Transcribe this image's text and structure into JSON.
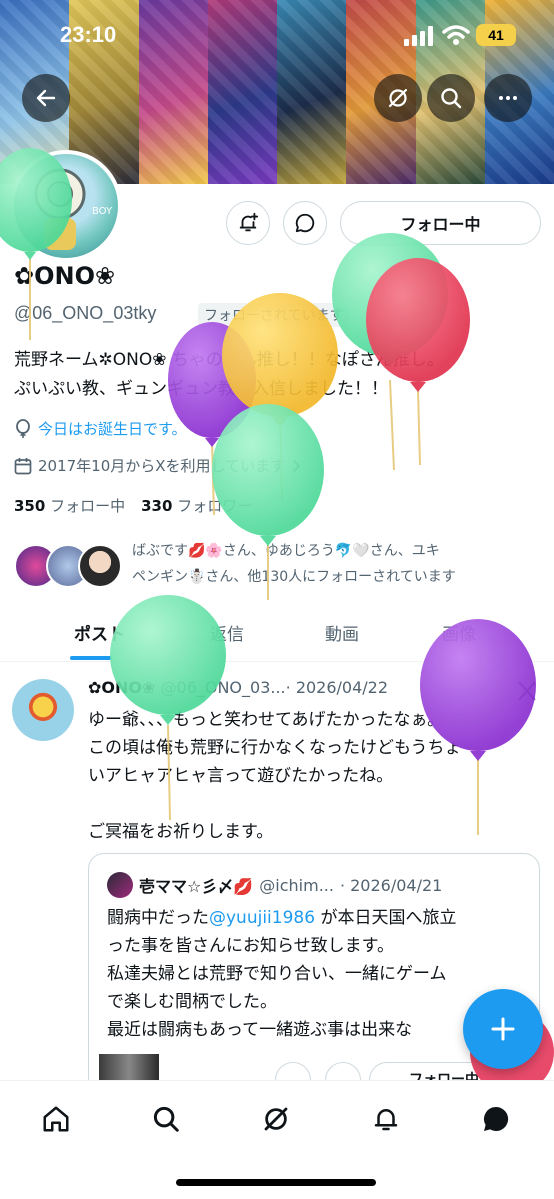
{
  "status_bar": {
    "time": "23:10",
    "battery": "41"
  },
  "banner": {
    "colors": [
      "#4a7fc9",
      "#d8c45a",
      "#5b2f8a",
      "#b43a7a",
      "#3a7ab5",
      "#c24a4a",
      "#3d9a8c",
      "#f1b233"
    ]
  },
  "profile": {
    "name": "✿ONO❀",
    "handle": "@06_ONO_03tky",
    "follows_you": "フォローされています",
    "bio_line1": "荒野ネーム✲ONO❀ ちゃのさん推し！！なぽさん推し。",
    "bio_line2": "ぷいぷい教、ギュンギュン教に入信しました！！",
    "birthday": "今日はお誕生日です。",
    "joined": "2017年10月からXを利用しています",
    "following_count": "350",
    "following_label": "フォロー中",
    "followers_count": "330",
    "followers_label": "フォロワー",
    "followed_by_line1": "ばぶです💋🌸さん、ゆあじろう🐬🤍さん、ユキ",
    "followed_by_line2": "ペンギン☃️さん、他130人にフォローされています",
    "follow_button": "フォロー中"
  },
  "tabs": [
    "ポスト",
    "返信",
    "動画",
    "画像"
  ],
  "post": {
    "author": "✿ONO❀",
    "handle": "@06_ONO_03...",
    "date": "· 2026/04/22",
    "line1": "ゆー爺、、、もっと笑わせてあげたかったなぁ。",
    "line2": "この頃は俺も荒野に行かなくなったけどもうちょ",
    "line3": "いアヒャアヒャ言って遊びたかったね。",
    "line4": "ご冥福をお祈りします。",
    "quote": {
      "author": "壱ママ☆彡〆💋",
      "handle": "@ichim...",
      "date": "· 2026/04/21",
      "line1_pre": "闘病中だった",
      "mention": "@yuujii1986",
      "line1_post": " が本日天国へ旅立",
      "line2": "った事を皆さんにお知らせ致します。",
      "line3": "私達夫婦とは荒野で知り合い、一緒にゲーム",
      "line4": "で楽しむ間柄でした。",
      "line5": "最近は闘病もあって一緒遊ぶ事は出来な"
    }
  },
  "quote_follow_button": "フォロー中",
  "icons": {
    "back": "back-arrow-icon",
    "grok": "grok-icon",
    "search": "search-icon",
    "more": "more-icon",
    "notify": "bell-plus-icon",
    "message": "message-icon",
    "compose": "plus-icon",
    "home": "home-icon",
    "explore": "search-icon",
    "notifications": "bell-icon",
    "dm": "chat-icon"
  },
  "accent": "#1d9bf0"
}
